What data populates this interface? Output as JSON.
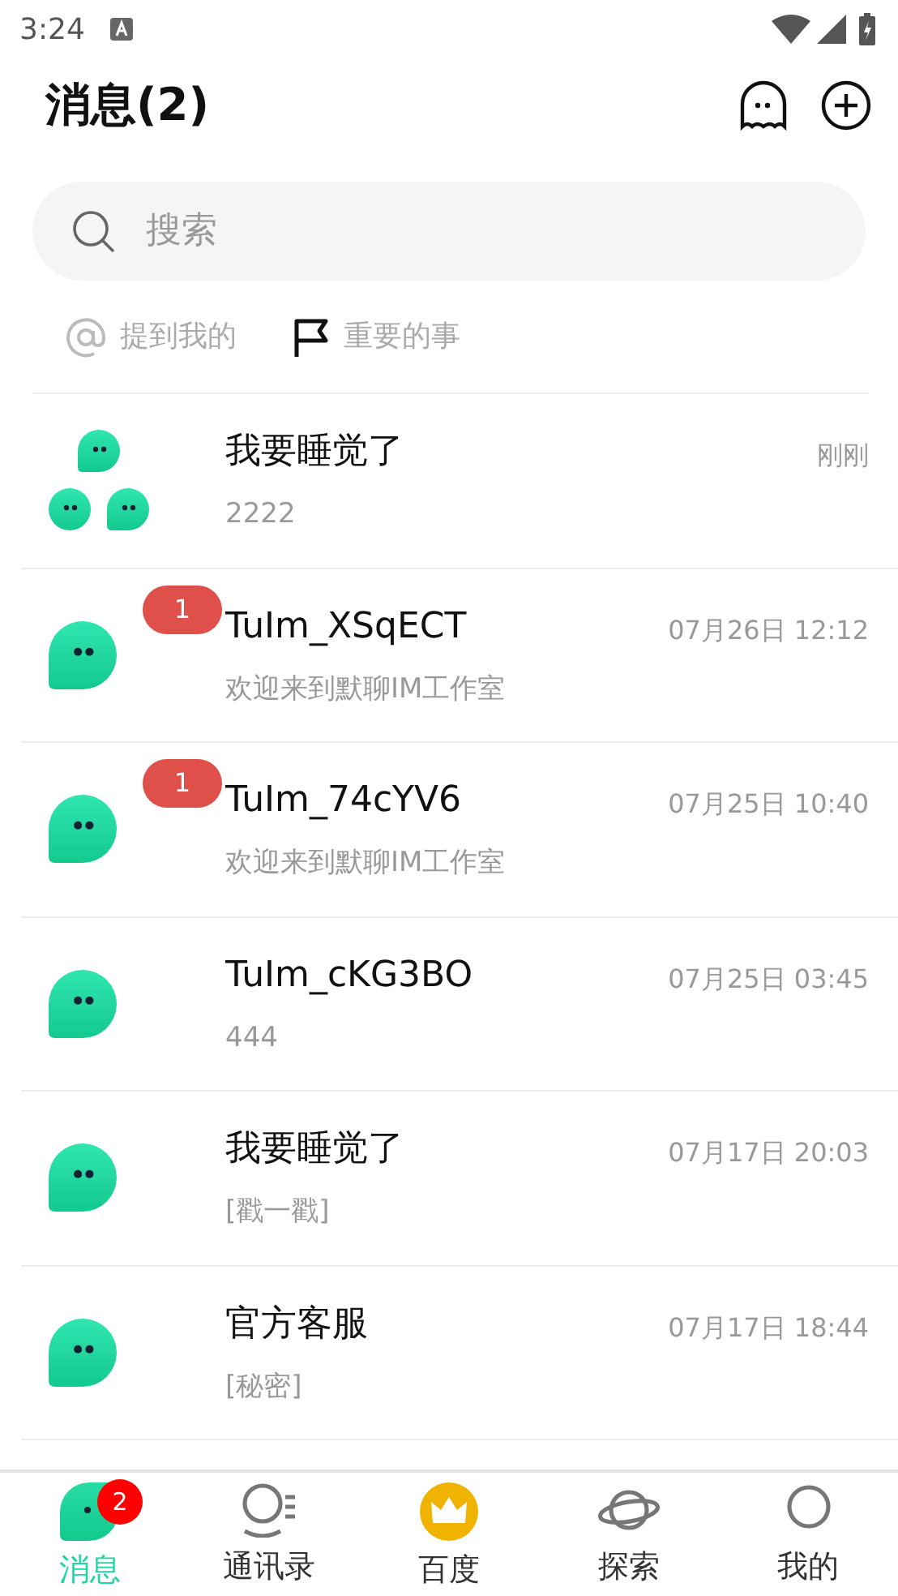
{
  "status_bar": {
    "time": "3:24"
  },
  "header": {
    "title": "消息(2)"
  },
  "search": {
    "placeholder": "搜索"
  },
  "filters": [
    {
      "kind": "mention",
      "label": "提到我的"
    },
    {
      "kind": "flag",
      "label": "重要的事"
    }
  ],
  "conversations": [
    {
      "kind": "group",
      "name": "我要睡觉了",
      "preview": "2222",
      "time": "刚刚"
    },
    {
      "kind": "single",
      "name": "TuIm_XSqECT",
      "preview": "欢迎来到默聊IM工作室",
      "time": "07月26日 12:12",
      "unread": "1"
    },
    {
      "kind": "single",
      "name": "TuIm_74cYV6",
      "preview": "欢迎来到默聊IM工作室",
      "time": "07月25日 10:40",
      "unread": "1"
    },
    {
      "kind": "single",
      "name": "TuIm_cKG3BO",
      "preview": "444",
      "time": "07月25日 03:45"
    },
    {
      "kind": "single",
      "name": "我要睡觉了",
      "preview": "[戳一戳]",
      "time": "07月17日 20:03"
    },
    {
      "kind": "single",
      "name": "官方客服",
      "preview": "[秘密]",
      "time": "07月17日 18:44"
    }
  ],
  "tab_bar": [
    {
      "kind": "messages",
      "label": "消息",
      "selected": true,
      "badge": "2"
    },
    {
      "kind": "contacts",
      "label": "通讯录",
      "selected": false
    },
    {
      "kind": "crown",
      "label": "百度",
      "selected": false
    },
    {
      "kind": "planet",
      "label": "探索",
      "selected": false
    },
    {
      "kind": "profile",
      "label": "我的",
      "selected": false
    }
  ]
}
